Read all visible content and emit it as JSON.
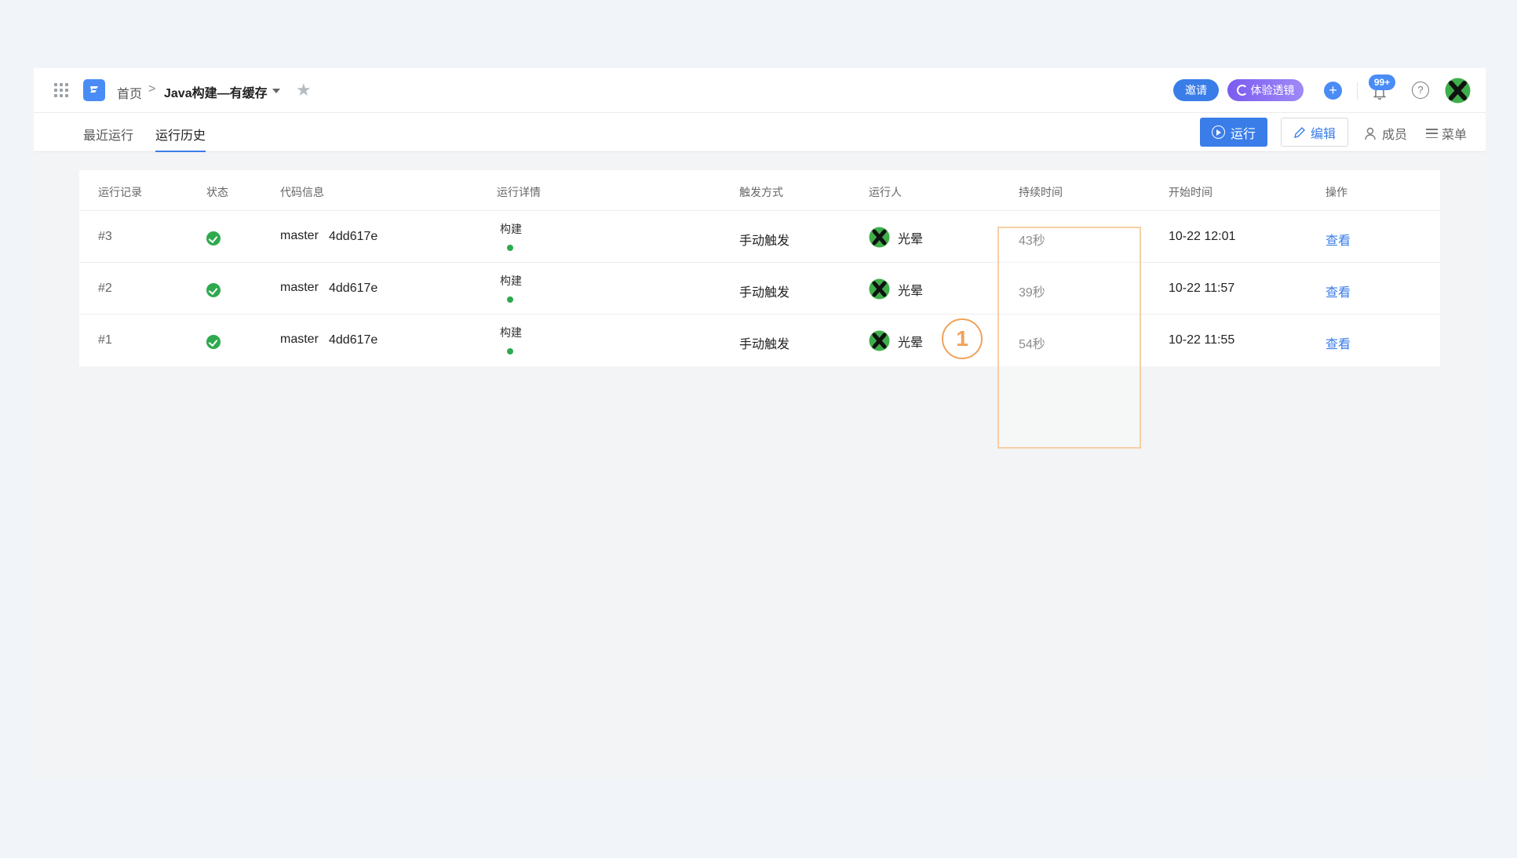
{
  "header": {
    "breadcrumb_home": "首页",
    "breadcrumb_sep": ">",
    "pipeline_title": "Java构建—有缓存",
    "invite_label": "邀请",
    "lens_label": "体验透镜",
    "plus_label": "+",
    "notification_count": "99+",
    "help_label": "?"
  },
  "subnav": {
    "tabs": [
      {
        "label": "最近运行"
      },
      {
        "label": "运行历史"
      }
    ],
    "run_label": "运行",
    "edit_label": "编辑",
    "members_label": "成员",
    "menu_label": "菜单"
  },
  "table": {
    "columns": [
      "运行记录",
      "状态",
      "代码信息",
      "运行详情",
      "触发方式",
      "运行人",
      "持续时间",
      "开始时间",
      "操作"
    ],
    "rows": [
      {
        "id": "#3",
        "branch": "master",
        "commit": "4dd617e",
        "stage": "构建",
        "trigger": "手动触发",
        "runner": "光晕",
        "duration": "43秒",
        "start": "10-22 12:01",
        "action": "查看"
      },
      {
        "id": "#2",
        "branch": "master",
        "commit": "4dd617e",
        "stage": "构建",
        "trigger": "手动触发",
        "runner": "光晕",
        "duration": "39秒",
        "start": "10-22 11:57",
        "action": "查看"
      },
      {
        "id": "#1",
        "branch": "master",
        "commit": "4dd617e",
        "stage": "构建",
        "trigger": "手动触发",
        "runner": "光晕",
        "duration": "54秒",
        "start": "10-22 11:55",
        "action": "查看"
      }
    ]
  },
  "annotation": {
    "marker_label": "1"
  },
  "colors": {
    "accent": "#3a7de8",
    "success": "#2eaa4e",
    "highlight": "#f6cfa6",
    "marker": "#f0a25a"
  }
}
